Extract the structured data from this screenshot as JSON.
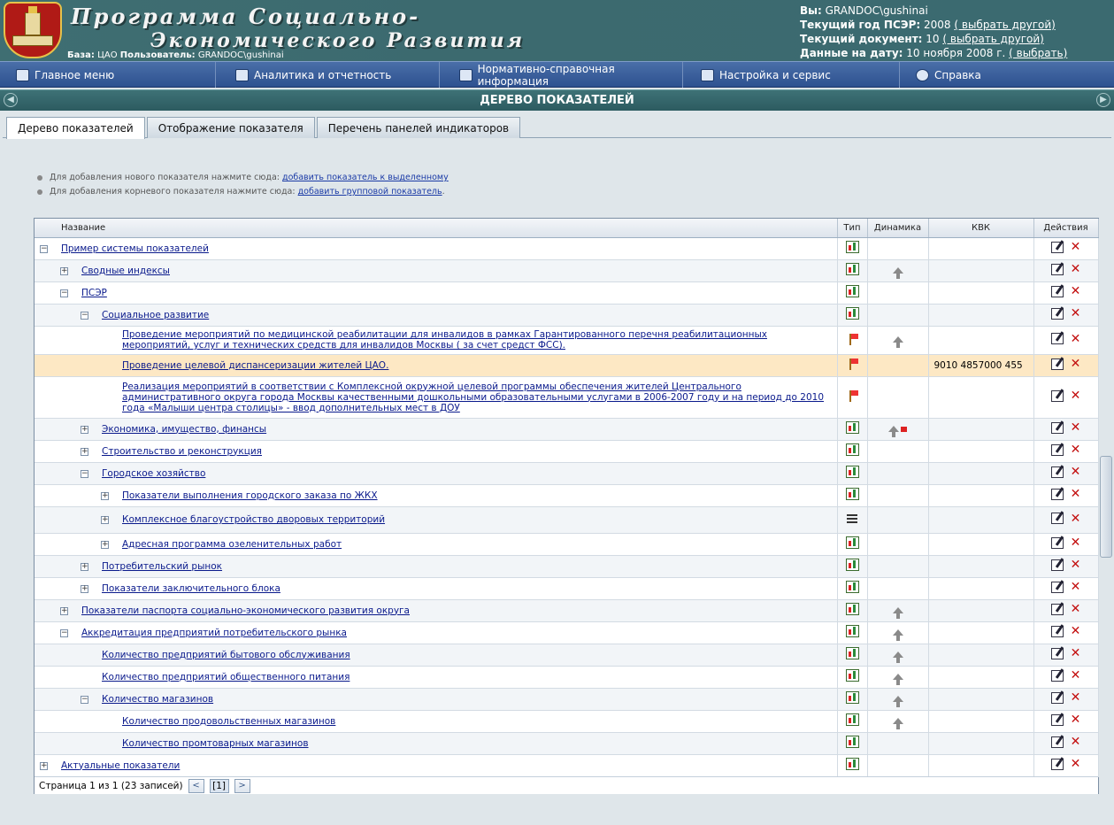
{
  "header": {
    "title_line1": "Программа Социально-",
    "title_line2": "Экономического Развития",
    "base_label": "База:",
    "base_value": "ЦАО",
    "user_label": "Пользователь:",
    "user_value": "GRANDOC\\gushinai",
    "you_label": "Вы:",
    "you_value": "GRANDOC\\gushinai",
    "year_label": "Текущий год ПСЭР:",
    "year_value": "2008",
    "year_link": "( выбрать другой)",
    "doc_label": "Текущий документ:",
    "doc_value": "10",
    "doc_link": "( выбрать другой)",
    "date_label": "Данные на дату:",
    "date_value": "10 ноября 2008 г.",
    "date_link": "( выбрать)"
  },
  "menu": [
    {
      "label": "Главное меню",
      "icon": "monitor-icon"
    },
    {
      "label": "Аналитика и отчетность",
      "icon": "book-icon"
    },
    {
      "label": "Нормативно-справочная информация",
      "icon": "search-doc-icon"
    },
    {
      "label": "Настройка и сервис",
      "icon": "settings-icon"
    },
    {
      "label": "Справка",
      "icon": "help-icon"
    }
  ],
  "section_title": "Дерево показателей",
  "tabs": [
    "Дерево показателей",
    "Отображение показателя",
    "Перечень панелей индикаторов"
  ],
  "hints": [
    {
      "text": "Для добавления нового показателя нажмите сюда:",
      "link": "добавить показатель к выделенному",
      "end": ""
    },
    {
      "text": "Для добавления корневого показателя нажмите сюда:",
      "link": "добавить групповой показатель",
      "end": "."
    }
  ],
  "grid": {
    "columns": [
      "Название",
      "Тип",
      "Динамика",
      "КВК",
      "Действия"
    ],
    "rows": [
      {
        "level": 0,
        "toggle": "−",
        "name": "Пример системы показателей",
        "type": "chart",
        "dyn": "",
        "kvk": ""
      },
      {
        "level": 1,
        "toggle": "+",
        "name": "Сводные индексы",
        "type": "chart",
        "dyn": "up",
        "kvk": ""
      },
      {
        "level": 1,
        "toggle": "−",
        "name": "ПСЭР",
        "type": "chart",
        "dyn": "",
        "kvk": ""
      },
      {
        "level": 2,
        "toggle": "−",
        "name": "Социальное развитие",
        "type": "chart",
        "dyn": "",
        "kvk": ""
      },
      {
        "level": 3,
        "toggle": "",
        "name": "Проведение мероприятий по медицинской реабилитации для инвалидов в рамках Гарантированного перечня реабилитационных мероприятий, услуг и технических средств для инвалидов Москвы ( за счет средст ФСС).",
        "type": "flag",
        "dyn": "up",
        "kvk": ""
      },
      {
        "level": 3,
        "toggle": "",
        "name": "Проведение целевой диспансеризации жителей ЦАО.",
        "type": "flag",
        "dyn": "",
        "kvk": "9010 4857000 455",
        "selected": true
      },
      {
        "level": 3,
        "toggle": "",
        "name": "Реализация мероприятий в соответствии с Комплексной окружной целевой программы обеспечения жителей Центрального административного округа города Москвы качественными дошкольными образовательными услугами в 2006-2007 году и на период до 2010 года «Малыши центра столицы» - ввод дополнительных мест в ДОУ",
        "type": "flag",
        "dyn": "",
        "kvk": ""
      },
      {
        "level": 2,
        "toggle": "+",
        "name": "Экономика, имущество, финансы",
        "type": "chart",
        "dyn": "upflag",
        "kvk": ""
      },
      {
        "level": 2,
        "toggle": "+",
        "name": "Строительство и реконструкция",
        "type": "chart",
        "dyn": "",
        "kvk": ""
      },
      {
        "level": 2,
        "toggle": "−",
        "name": "Городское хозяйство",
        "type": "chart",
        "dyn": "",
        "kvk": ""
      },
      {
        "level": 3,
        "toggle": "+",
        "name": "Показатели выполнения городского заказа по ЖКХ",
        "type": "chart",
        "dyn": "",
        "kvk": ""
      },
      {
        "level": 3,
        "toggle": "+",
        "name": "Комплексное благоустройство дворовых территорий",
        "type": "list",
        "dyn": "",
        "kvk": ""
      },
      {
        "level": 3,
        "toggle": "+",
        "name": "Адресная программа озеленительных работ",
        "type": "chart",
        "dyn": "",
        "kvk": ""
      },
      {
        "level": 2,
        "toggle": "+",
        "name": "Потребительский рынок",
        "type": "chart",
        "dyn": "",
        "kvk": ""
      },
      {
        "level": 2,
        "toggle": "+",
        "name": "Показатели заключительного блока",
        "type": "chart",
        "dyn": "",
        "kvk": ""
      },
      {
        "level": 1,
        "toggle": "+",
        "name": "Показатели паспорта социально-экономического развития округа",
        "type": "chart",
        "dyn": "up",
        "kvk": ""
      },
      {
        "level": 1,
        "toggle": "−",
        "name": "Аккредитация предприятий потребительского рынка",
        "type": "chart",
        "dyn": "up",
        "kvk": ""
      },
      {
        "level": 2,
        "toggle": "",
        "name": "Количество предприятий бытового обслуживания",
        "type": "chart",
        "dyn": "up",
        "kvk": ""
      },
      {
        "level": 2,
        "toggle": "",
        "name": "Количество предприятий общественного питания",
        "type": "chart",
        "dyn": "up",
        "kvk": ""
      },
      {
        "level": 2,
        "toggle": "−",
        "name": "Количество магазинов",
        "type": "chart",
        "dyn": "up",
        "kvk": ""
      },
      {
        "level": 3,
        "toggle": "",
        "name": "Количество продовольственных магазинов",
        "type": "chart",
        "dyn": "up",
        "kvk": ""
      },
      {
        "level": 3,
        "toggle": "",
        "name": "Количество промтоварных магазинов",
        "type": "chart",
        "dyn": "",
        "kvk": ""
      },
      {
        "level": 0,
        "toggle": "+",
        "name": "Актуальные показатели",
        "type": "chart",
        "dyn": "",
        "kvk": ""
      }
    ]
  },
  "pager": {
    "text": "Страница 1 из 1 (23 записей)",
    "prev": "<",
    "page": "[1]",
    "next": ">"
  }
}
